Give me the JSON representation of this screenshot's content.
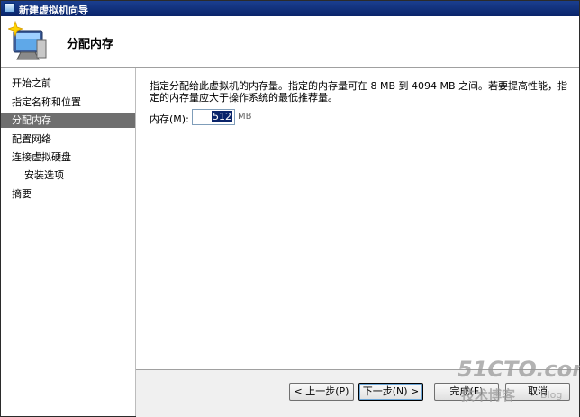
{
  "window": {
    "title": "新建虚拟机向导"
  },
  "header": {
    "title": "分配内存"
  },
  "sidebar": {
    "items": [
      {
        "label": "开始之前",
        "active": false,
        "sub": false
      },
      {
        "label": "指定名称和位置",
        "active": false,
        "sub": false
      },
      {
        "label": "分配内存",
        "active": true,
        "sub": false
      },
      {
        "label": "配置网络",
        "active": false,
        "sub": false
      },
      {
        "label": "连接虚拟硬盘",
        "active": false,
        "sub": false
      },
      {
        "label": "安装选项",
        "active": false,
        "sub": true
      },
      {
        "label": "摘要",
        "active": false,
        "sub": false
      }
    ]
  },
  "main": {
    "description_line1": "指定分配给此虚拟机的内存量。指定的内存量可在 8 MB 到 4094 MB 之间。若要提高性能，指",
    "description_line2": "定的内存量应大于操作系统的最低推荐量。",
    "memory_label": "内存(M):",
    "memory_value": "512",
    "memory_unit": "MB"
  },
  "buttons": {
    "prev": "< 上一步(P)",
    "next": "下一步(N) >",
    "finish": "完成(F)",
    "cancel": "取消"
  },
  "watermark": {
    "logo": "51CTO.com",
    "subtitle": "技术博客",
    "blog": "Blog"
  }
}
